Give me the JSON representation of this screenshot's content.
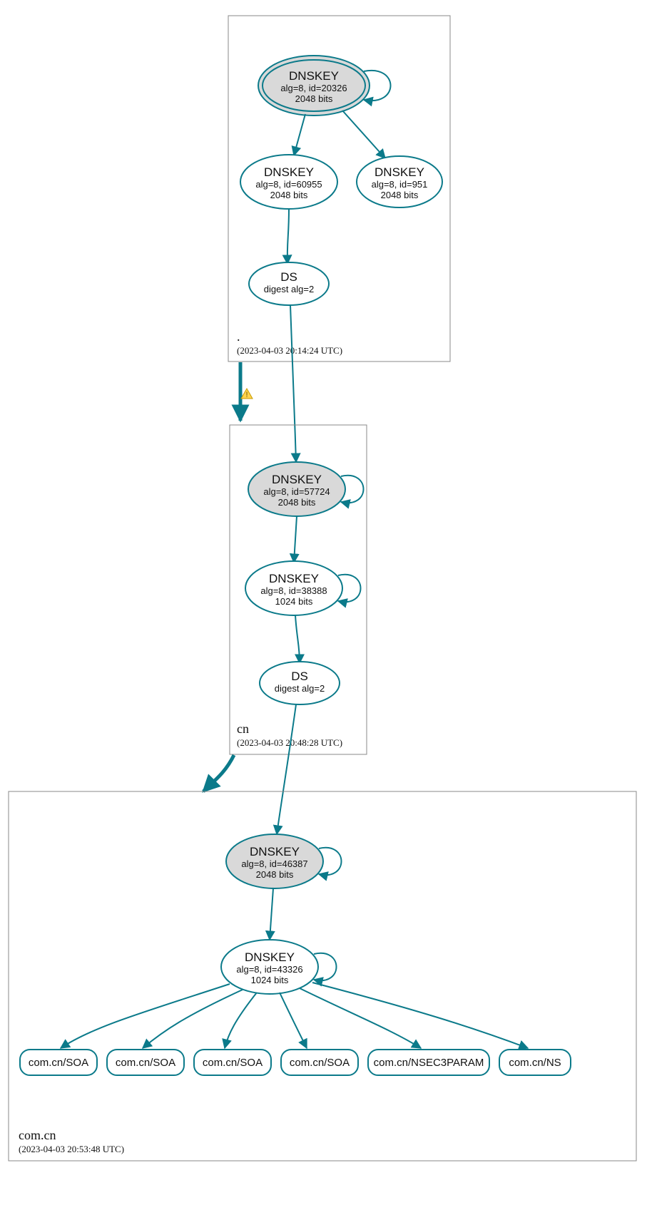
{
  "zones": {
    "root": {
      "name": ".",
      "timestamp": "(2023-04-03 20:14:24 UTC)"
    },
    "cn": {
      "name": "cn",
      "timestamp": "(2023-04-03 20:48:28 UTC)"
    },
    "comcn": {
      "name": "com.cn",
      "timestamp": "(2023-04-03 20:53:48 UTC)"
    }
  },
  "nodes": {
    "root_ksk": {
      "title": "DNSKEY",
      "line2": "alg=8, id=20326",
      "line3": "2048 bits"
    },
    "root_zsk1": {
      "title": "DNSKEY",
      "line2": "alg=8, id=60955",
      "line3": "2048 bits"
    },
    "root_zsk2": {
      "title": "DNSKEY",
      "line2": "alg=8, id=951",
      "line3": "2048 bits"
    },
    "root_ds": {
      "title": "DS",
      "line2": "digest alg=2",
      "line3": ""
    },
    "cn_ksk": {
      "title": "DNSKEY",
      "line2": "alg=8, id=57724",
      "line3": "2048 bits"
    },
    "cn_zsk": {
      "title": "DNSKEY",
      "line2": "alg=8, id=38388",
      "line3": "1024 bits"
    },
    "cn_ds": {
      "title": "DS",
      "line2": "digest alg=2",
      "line3": ""
    },
    "comcn_ksk": {
      "title": "DNSKEY",
      "line2": "alg=8, id=46387",
      "line3": "2048 bits"
    },
    "comcn_zsk": {
      "title": "DNSKEY",
      "line2": "alg=8, id=43326",
      "line3": "1024 bits"
    }
  },
  "leaves": {
    "l1": "com.cn/SOA",
    "l2": "com.cn/SOA",
    "l3": "com.cn/SOA",
    "l4": "com.cn/SOA",
    "l5": "com.cn/NSEC3PARAM",
    "l6": "com.cn/NS"
  }
}
